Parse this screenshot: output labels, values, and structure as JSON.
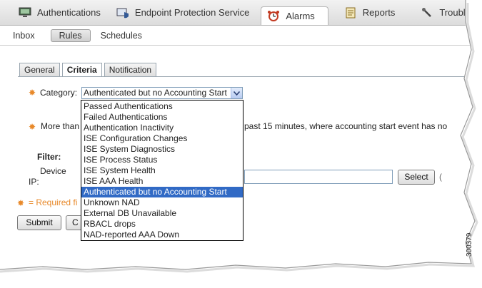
{
  "top_nav": {
    "items": [
      {
        "label": "Authentications",
        "icon": "monitor-icon",
        "active": false
      },
      {
        "label": "Endpoint Protection Service",
        "icon": "endpoint-shield-icon",
        "active": false
      },
      {
        "label": "Alarms",
        "icon": "alarm-clock-icon",
        "active": true
      },
      {
        "label": "Reports",
        "icon": "reports-icon",
        "active": false
      },
      {
        "label": "Troubleshoot",
        "icon": "wrench-icon",
        "active": false
      }
    ]
  },
  "sub_nav": {
    "items": [
      {
        "label": "Inbox",
        "active": false
      },
      {
        "label": "Rules",
        "active": true
      },
      {
        "label": "Schedules",
        "active": false
      }
    ]
  },
  "tabs": [
    {
      "label": "General",
      "active": false
    },
    {
      "label": "Criteria",
      "active": true
    },
    {
      "label": "Notification",
      "active": false
    }
  ],
  "form": {
    "category_label": "Category:",
    "category_value": "Authenticated but no Accounting Start",
    "dropdown_options": [
      "Passed Authentications",
      "Failed Authentications",
      "Authentication Inactivity",
      "ISE Configuration Changes",
      "ISE System Diagnostics",
      "ISE Process Status",
      "ISE System Health",
      "ISE AAA Health",
      "Authenticated but no Accounting Start",
      "Unknown NAD",
      "External DB Unavailable",
      "RBACL drops",
      "NAD-reported AAA Down"
    ],
    "selected_index": 8,
    "more_than_prefix": "More than",
    "more_than_suffix": "past 15 minutes, where accounting start event has no",
    "filter_label": "Filter:",
    "device_label": "Device",
    "ip_label": "IP:",
    "select_button": "Select",
    "required_note": "= Required fi",
    "submit_button": "Submit",
    "cancel_button_partial": "C"
  },
  "figure_number": "300379",
  "colors": {
    "required_icon": "#e8892a",
    "selection": "#316ac5"
  }
}
